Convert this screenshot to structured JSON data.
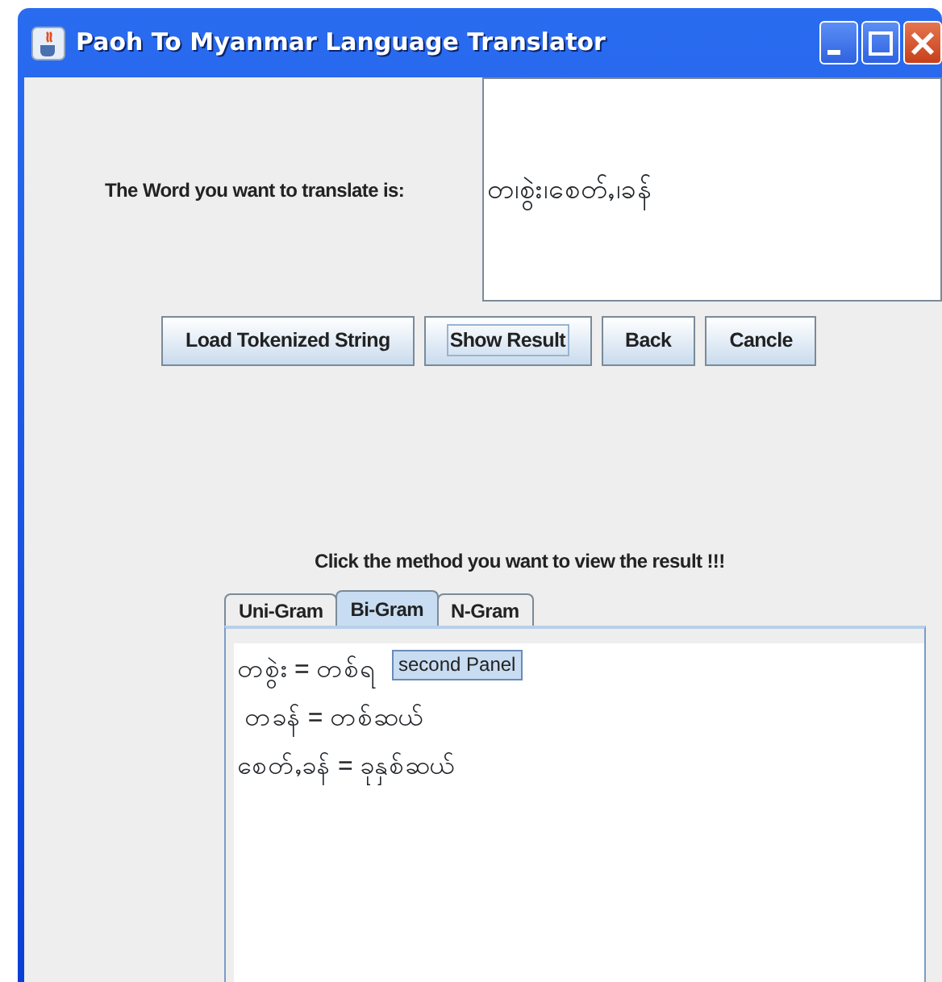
{
  "window": {
    "title": "Paoh To Myanmar Language Translator"
  },
  "prompt_label": "The Word you want to translate is:",
  "input_text": "တ၊စွဲး၊စေတ်ႇ၊ခန်",
  "buttons": [
    {
      "label": "Load Tokenized String",
      "focused": false
    },
    {
      "label": "Show Result",
      "focused": true
    },
    {
      "label": "Back",
      "focused": false
    },
    {
      "label": "Cancle",
      "focused": false
    }
  ],
  "method_label": "Click the method you want to view the result  !!!",
  "tabs": [
    {
      "label": "Uni-Gram",
      "selected": false
    },
    {
      "label": "Bi-Gram",
      "selected": true
    },
    {
      "label": "N-Gram",
      "selected": false
    }
  ],
  "results": [
    "တစွဲး = တစ်ရ",
    " တခန် = တစ်ဆယ်",
    "စေတ်ႇခန် = ခုနှစ်ဆယ်"
  ],
  "tooltip": "second Panel"
}
